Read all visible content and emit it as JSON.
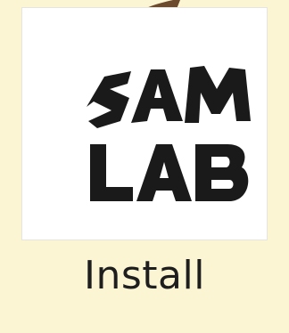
{
  "shortcut": {
    "label": "Install",
    "logo_text_line1": "SAM",
    "logo_text_line2": "LAB",
    "logo_color": "#1a1a1a"
  },
  "theme": {
    "background": "#fcf5d4",
    "tile_background": "#ffffff",
    "arrow_color": "#6b4a2d"
  },
  "icons": {
    "overlay": "shortcut-arrow-icon",
    "app": "sam-lab-logo-icon"
  }
}
